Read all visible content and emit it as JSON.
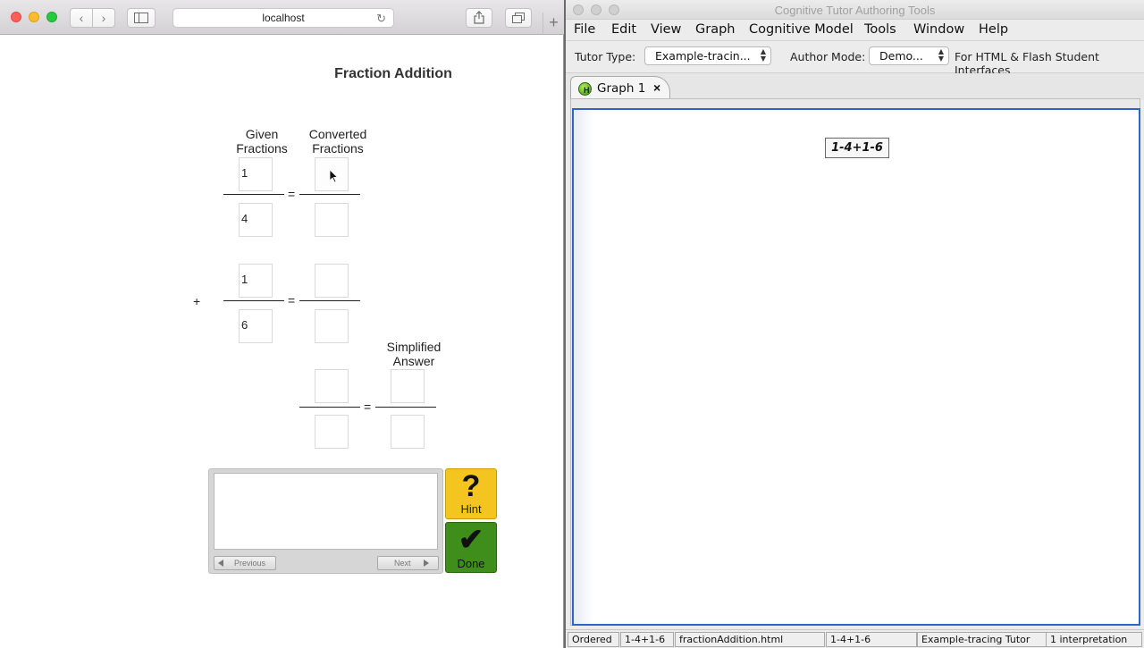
{
  "browser": {
    "address": "localhost"
  },
  "tutor": {
    "title": "Fraction Addition",
    "headers": {
      "given": "Given\nFractions",
      "converted": "Converted\nFractions",
      "simplified": "Simplified\nAnswer"
    },
    "fraction1": {
      "numerator": "1",
      "denominator": "4"
    },
    "fraction2": {
      "numerator": "1",
      "denominator": "6"
    },
    "operator_plus": "+",
    "equals": "=",
    "prev_label": "Previous",
    "next_label": "Next",
    "hint_label": "Hint",
    "hint_glyph": "?",
    "done_label": "Done",
    "done_glyph": "✔",
    "hint_color": "#f5c51f",
    "done_color": "#3f8d1a"
  },
  "ctat": {
    "window_title": "Cognitive Tutor Authoring Tools",
    "menu": [
      "File",
      "Edit",
      "View",
      "Graph",
      "Cognitive Model",
      "Tools",
      "Window",
      "Help"
    ],
    "tutor_type_label": "Tutor Type:",
    "tutor_type_value": "Example-tracin...",
    "author_mode_label": "Author Mode:",
    "author_mode_value": "Demo...",
    "interface_note": "For HTML & Flash Student Interfaces",
    "tab_label": "Graph 1",
    "tab_close": "×",
    "start_node": "1-4+1-6",
    "status": [
      "Ordered",
      "1-4+1-6",
      "fractionAddition.html",
      "1-4+1-6",
      "Example-tracing Tutor",
      "1 interpretation"
    ],
    "canvas_border_color": "#3264c8"
  }
}
